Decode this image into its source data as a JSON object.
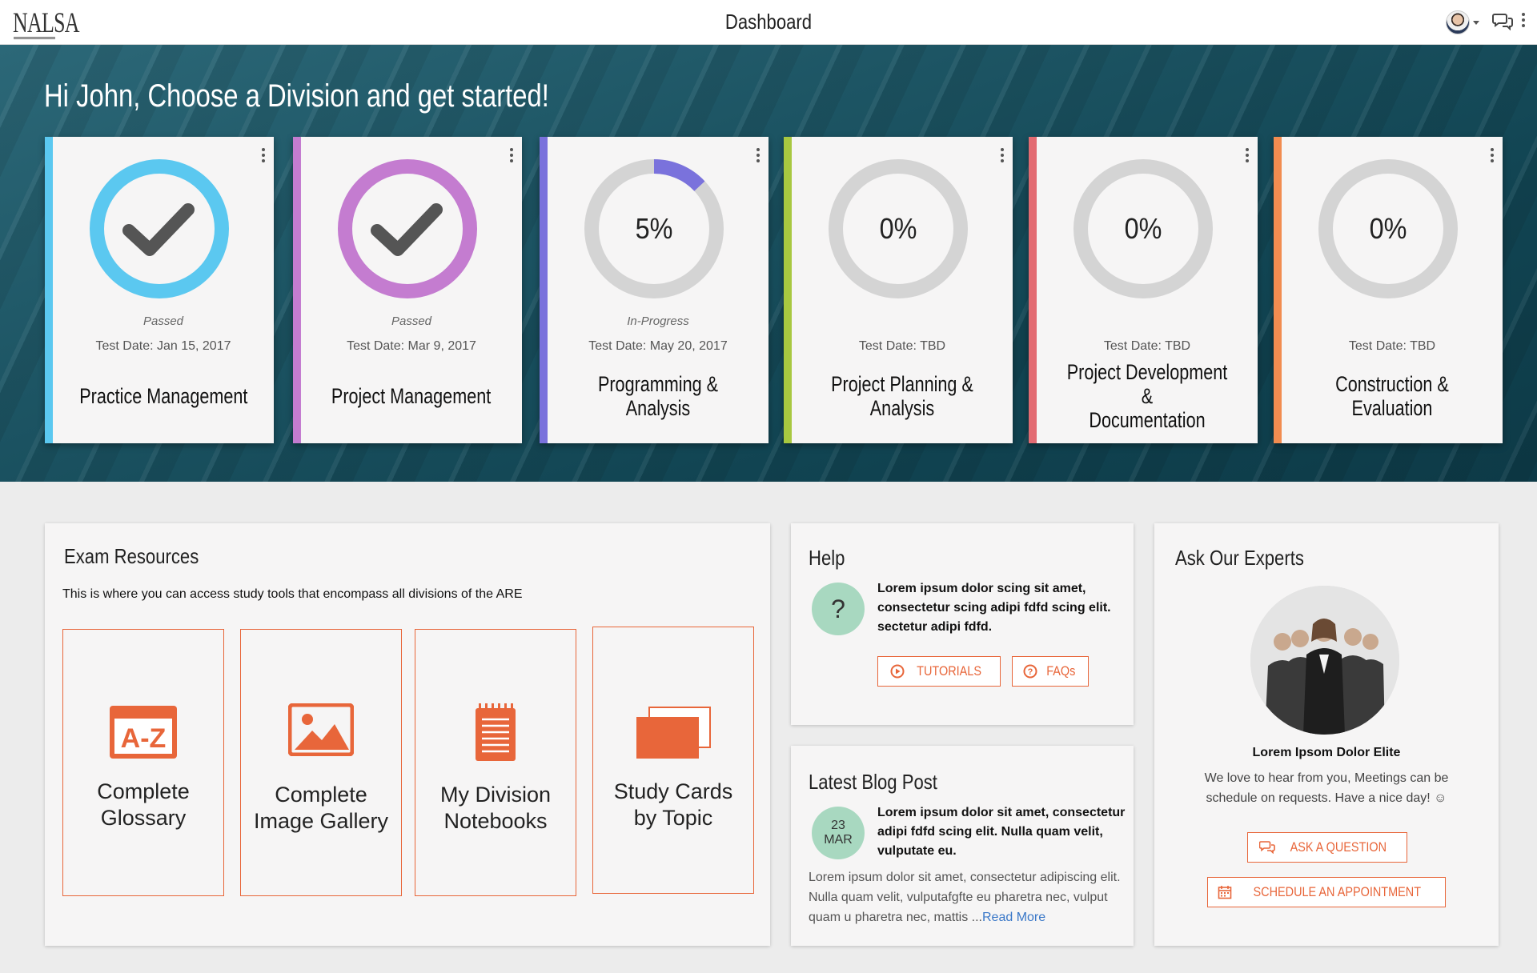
{
  "app": {
    "logo": "NALSA",
    "title": "Dashboard"
  },
  "header": {
    "avatar_icon": "user-avatar",
    "chat_icon": "chat-bubbles-icon",
    "menu_icon": "kebab-menu-icon"
  },
  "hero": {
    "greeting": "Hi John, Choose a Division and get started!",
    "divisions": [
      {
        "name": "Practice Management",
        "status": "Passed",
        "test_date": "Test Date: Jan 15, 2017",
        "progress_label": "",
        "progress": 1.0,
        "passed": true,
        "color": "#5bc8f0"
      },
      {
        "name": "Project Management",
        "status": "Passed",
        "test_date": "Test Date: Mar 9, 2017",
        "progress_label": "",
        "progress": 1.0,
        "passed": true,
        "color": "#c47cd0"
      },
      {
        "name": "Programming & Analysis",
        "status": "In-Progress",
        "test_date": "Test Date: May 20, 2017",
        "progress_label": "5%",
        "progress": 0.05,
        "passed": false,
        "color": "#7a72dc"
      },
      {
        "name": "Project Planning & Analysis",
        "status": "",
        "test_date": "Test Date: TBD",
        "progress_label": "0%",
        "progress": 0,
        "passed": false,
        "color": "#a8c840"
      },
      {
        "name": "Project Development &\nDocumentation",
        "status": "",
        "test_date": "Test Date: TBD",
        "progress_label": "0%",
        "progress": 0,
        "passed": false,
        "color": "#e36b72"
      },
      {
        "name": "Construction & Evaluation",
        "status": "",
        "test_date": "Test Date: TBD",
        "progress_label": "0%",
        "progress": 0,
        "passed": false,
        "color": "#f28c50"
      }
    ]
  },
  "exam_resources": {
    "title": "Exam Resources",
    "description": "This is where you can access study tools that encompass all divisions of the ARE",
    "tiles": [
      {
        "label": "Complete\nGlossary",
        "icon": "a-z-glossary-icon"
      },
      {
        "label": "Complete\nImage Gallery",
        "icon": "image-gallery-icon"
      },
      {
        "label": "My Division\nNotebooks",
        "icon": "notebook-icon"
      },
      {
        "label": "Study Cards\nby Topic",
        "icon": "study-cards-icon"
      }
    ]
  },
  "help": {
    "title": "Help",
    "badge": "?",
    "text": "Lorem ipsum dolor scing sit amet, consectetur scing adipi fdfd scing elit. sectetur adipi fdfd.",
    "tutorials_label": "TUTORIALS",
    "faqs_label": "FAQs"
  },
  "blog": {
    "title": "Latest Blog Post",
    "day": "23",
    "month": "MAR",
    "lead": "Lorem ipsum dolor sit amet, consectetur adipi fdfd scing elit. Nulla quam velit, vulputate eu.",
    "body": "Lorem ipsum dolor sit amet, consectetur adipiscing elit. Nulla quam velit, vulputafgfte eu pharetra nec, vulput quam u pharetra nec, mattis ...",
    "read_more": "Read More"
  },
  "experts": {
    "title": "Ask Our Experts",
    "name": "Lorem Ipsom Dolor Elite",
    "text": "We love to hear from you, Meetings can be schedule on requests. Have a nice day! ☺",
    "ask_label": "ASK A QUESTION",
    "schedule_label": "SCHEDULE AN APPOINTMENT"
  },
  "colors": {
    "accent": "#e8663a",
    "hero_bg": "#114452",
    "ring_track": "#d4d4d4"
  }
}
